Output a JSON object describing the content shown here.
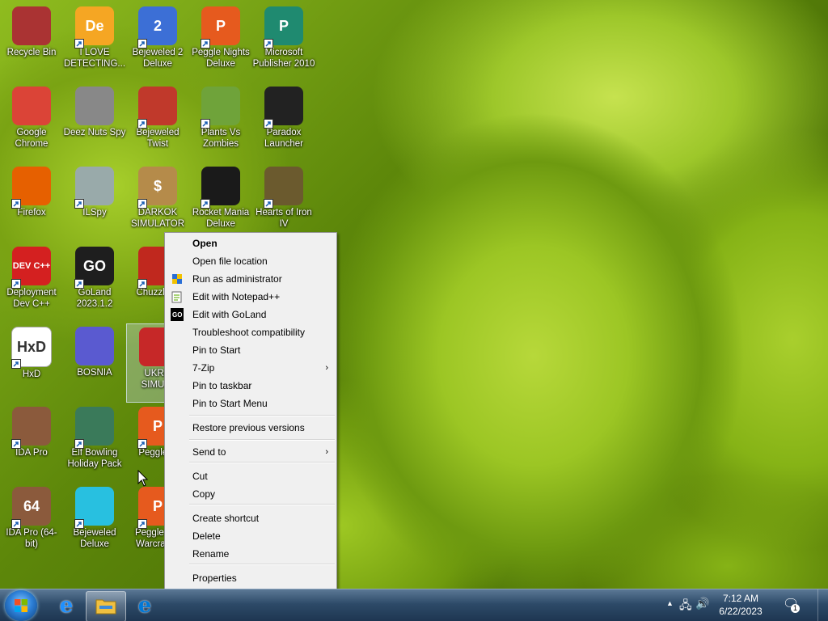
{
  "desktop": {
    "icons": [
      {
        "label": "Recycle Bin",
        "icon": "recycle-bin-icon",
        "color": "#a33",
        "glyph": "",
        "shortcut": false
      },
      {
        "label": "I LOVE DETECTING...",
        "icon": "game-de-icon",
        "color": "#f5a623",
        "glyph": "De",
        "shortcut": true
      },
      {
        "label": "Bejeweled 2 Deluxe",
        "icon": "bejeweled-2-icon",
        "color": "#3c6fd6",
        "glyph": "2",
        "shortcut": true
      },
      {
        "label": "Peggle Nights Deluxe",
        "icon": "peggle-nights-icon",
        "color": "#e65a1e",
        "glyph": "P",
        "shortcut": true
      },
      {
        "label": "Microsoft Publisher 2010",
        "icon": "publisher-icon",
        "color": "#1f8a70",
        "glyph": "P",
        "shortcut": true
      },
      {
        "label": "Google Chrome",
        "icon": "chrome-icon",
        "color": "#db4437",
        "glyph": "",
        "shortcut": false
      },
      {
        "label": "Deez Nuts Spy",
        "icon": "windows-stack-icon",
        "color": "#888",
        "glyph": "",
        "shortcut": false
      },
      {
        "label": "Bejeweled Twist",
        "icon": "bejeweled-twist-icon",
        "color": "#c0392b",
        "glyph": "",
        "shortcut": true
      },
      {
        "label": "Plants Vs Zombies",
        "icon": "plants-vs-zombies-icon",
        "color": "#6fa33a",
        "glyph": "",
        "shortcut": true
      },
      {
        "label": "Paradox Launcher",
        "icon": "paradox-icon",
        "color": "#222",
        "glyph": "",
        "shortcut": true
      },
      {
        "label": "Firefox",
        "icon": "firefox-icon",
        "color": "#e66000",
        "glyph": "",
        "shortcut": true
      },
      {
        "label": "ILSpy",
        "icon": "ilspy-icon",
        "color": "#9aa",
        "glyph": "",
        "shortcut": true
      },
      {
        "label": "DARKOK SIMULATOR",
        "icon": "money-bag-icon",
        "color": "#b58b4a",
        "glyph": "$",
        "shortcut": true
      },
      {
        "label": "Rocket Mania Deluxe",
        "icon": "rocket-mania-icon",
        "color": "#1a1a1a",
        "glyph": "",
        "shortcut": true
      },
      {
        "label": "Hearts of Iron IV",
        "icon": "hearts-of-iron-icon",
        "color": "#6b5a2e",
        "glyph": "",
        "shortcut": true
      },
      {
        "label": "Deployment Dev C++",
        "icon": "dev-cpp-icon",
        "color": "#d42020",
        "glyph": "DEV C++",
        "shortcut": true
      },
      {
        "label": "GoLand 2023.1.2",
        "icon": "goland-icon",
        "color": "#1e1e1e",
        "glyph": "GO",
        "shortcut": true
      },
      {
        "label": "Chuzzle D",
        "icon": "chuzzle-icon",
        "color": "#c0281e",
        "glyph": "",
        "shortcut": true
      },
      {
        "label": "HxD",
        "icon": "hxd-icon",
        "color": "#ffffff",
        "glyph": "HxD",
        "shortcut": true
      },
      {
        "label": "BOSNIA",
        "icon": "spiked-ball-icon",
        "color": "#5a5ad0",
        "glyph": "",
        "shortcut": false
      },
      {
        "label": "UKRAI SIMULA",
        "icon": "radiation-icon",
        "color": "#c62828",
        "glyph": "",
        "shortcut": false
      },
      {
        "label": "IDA Pro",
        "icon": "ida-pro-icon",
        "color": "#8b5a3c",
        "glyph": "",
        "shortcut": true
      },
      {
        "label": "Elf Bowling Holiday Pack",
        "icon": "elf-bowling-icon",
        "color": "#3a7a5a",
        "glyph": "",
        "shortcut": true
      },
      {
        "label": "Peggle D",
        "icon": "peggle-icon",
        "color": "#e65a1e",
        "glyph": "P",
        "shortcut": true
      },
      {
        "label": "IDA Pro (64-bit)",
        "icon": "ida-pro-64-icon",
        "color": "#8b5a3c",
        "glyph": "64",
        "shortcut": true
      },
      {
        "label": "Bejeweled Deluxe",
        "icon": "diamond-icon",
        "color": "#28c0e0",
        "glyph": "",
        "shortcut": true
      },
      {
        "label": "Peggle Wo Warcraft E",
        "icon": "peggle-warcraft-icon",
        "color": "#e65a1e",
        "glyph": "P",
        "shortcut": true
      }
    ]
  },
  "context_menu": {
    "items": [
      {
        "label": "Open",
        "bold": true,
        "icon": "",
        "submenu": false
      },
      {
        "label": "Open file location",
        "bold": false,
        "icon": "",
        "submenu": false
      },
      {
        "label": "Run as administrator",
        "bold": false,
        "icon": "uac-shield-icon",
        "submenu": false
      },
      {
        "label": "Edit with Notepad++",
        "bold": false,
        "icon": "notepad-plus-plus-icon",
        "submenu": false
      },
      {
        "label": "Edit with GoLand",
        "bold": false,
        "icon": "goland-icon",
        "submenu": false
      },
      {
        "label": "Troubleshoot compatibility",
        "bold": false,
        "icon": "",
        "submenu": false
      },
      {
        "label": "Pin to Start",
        "bold": false,
        "icon": "",
        "submenu": false
      },
      {
        "label": "7-Zip",
        "bold": false,
        "icon": "",
        "submenu": true
      },
      {
        "label": "Pin to taskbar",
        "bold": false,
        "icon": "",
        "submenu": false
      },
      {
        "label": "Pin to Start Menu",
        "bold": false,
        "icon": "",
        "submenu": false
      },
      {
        "label": "Restore previous versions",
        "bold": false,
        "icon": "",
        "submenu": false
      },
      {
        "label": "Send to",
        "bold": false,
        "icon": "",
        "submenu": true
      },
      {
        "label": "Cut",
        "bold": false,
        "icon": "",
        "submenu": false
      },
      {
        "label": "Copy",
        "bold": false,
        "icon": "",
        "submenu": false
      },
      {
        "label": "Create shortcut",
        "bold": false,
        "icon": "",
        "submenu": false
      },
      {
        "label": "Delete",
        "bold": false,
        "icon": "",
        "submenu": false
      },
      {
        "label": "Rename",
        "bold": false,
        "icon": "",
        "submenu": false
      },
      {
        "label": "Properties",
        "bold": false,
        "icon": "",
        "submenu": false
      }
    ],
    "submenu_glyph": "›"
  },
  "taskbar": {
    "pinned": [
      {
        "name": "internet-explorer-icon",
        "glyph": "e",
        "color": "#1e90ff",
        "active": false
      },
      {
        "name": "file-explorer-icon",
        "glyph": "",
        "color": "#f0c040",
        "active": true
      },
      {
        "name": "edge-icon",
        "glyph": "e",
        "color": "#0078d7",
        "active": false
      }
    ],
    "tray": {
      "show_hidden_glyph": "▲",
      "network_glyph": "🖧",
      "volume_glyph": "🔊",
      "notification_glyph": "🗨",
      "notification_count": "1"
    },
    "clock": {
      "time": "7:12 AM",
      "date": "6/22/2023"
    }
  }
}
